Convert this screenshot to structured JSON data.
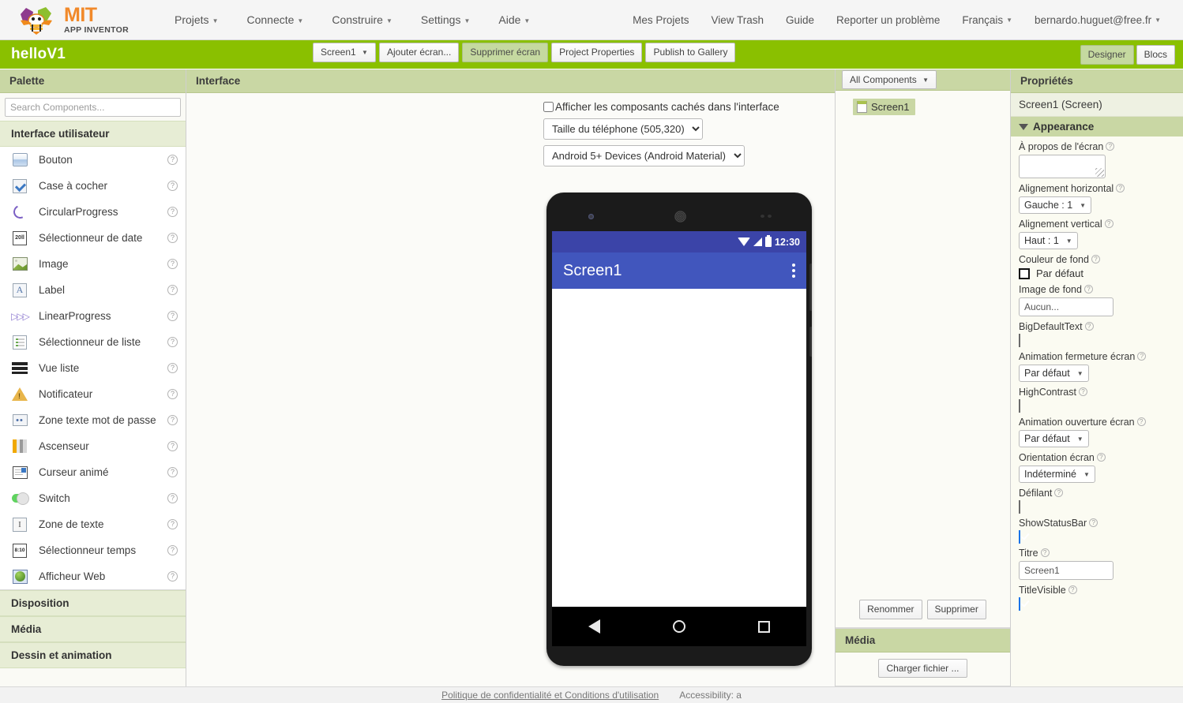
{
  "topbar": {
    "logo": {
      "mit": "MIT",
      "appinventor": "APP INVENTOR",
      "icon": "app-inventor-bee-logo"
    },
    "menu": [
      {
        "label": "Projets",
        "has_caret": true
      },
      {
        "label": "Connecte",
        "has_caret": true
      },
      {
        "label": "Construire",
        "has_caret": true
      },
      {
        "label": "Settings",
        "has_caret": true
      },
      {
        "label": "Aide",
        "has_caret": true
      }
    ],
    "right_menu": [
      {
        "label": "Mes Projets",
        "has_caret": false
      },
      {
        "label": "View Trash",
        "has_caret": false
      },
      {
        "label": "Guide",
        "has_caret": false
      },
      {
        "label": "Reporter un problème",
        "has_caret": false
      },
      {
        "label": "Français",
        "has_caret": true
      },
      {
        "label": "bernardo.huguet@free.fr",
        "has_caret": true
      }
    ]
  },
  "projectbar": {
    "title": "helloV1",
    "bar_color": "#8ac000",
    "screen_select": "Screen1",
    "buttons": [
      {
        "label": "Ajouter écran...",
        "selected": false
      },
      {
        "label": "Supprimer écran",
        "selected": true
      },
      {
        "label": "Project Properties",
        "selected": false
      },
      {
        "label": "Publish to Gallery",
        "selected": false
      }
    ],
    "view_toggle": [
      {
        "label": "Designer",
        "selected": true
      },
      {
        "label": "Blocs",
        "selected": false
      }
    ]
  },
  "palette": {
    "header": "Palette",
    "search_placeholder": "Search Components...",
    "search_value": "",
    "categories": [
      {
        "label": "Interface utilisateur",
        "expanded": true,
        "items": [
          {
            "label": "Bouton",
            "icon": "button-icon"
          },
          {
            "label": "Case à cocher",
            "icon": "checkbox-icon"
          },
          {
            "label": "CircularProgress",
            "icon": "circular-progress-icon"
          },
          {
            "label": "Sélectionneur de date",
            "icon": "date-picker-icon"
          },
          {
            "label": "Image",
            "icon": "image-icon"
          },
          {
            "label": "Label",
            "icon": "label-icon"
          },
          {
            "label": "LinearProgress",
            "icon": "linear-progress-icon"
          },
          {
            "label": "Sélectionneur de liste",
            "icon": "list-picker-icon"
          },
          {
            "label": "Vue liste",
            "icon": "list-view-icon"
          },
          {
            "label": "Notificateur",
            "icon": "notifier-icon"
          },
          {
            "label": "Zone texte mot de passe",
            "icon": "password-textbox-icon"
          },
          {
            "label": "Ascenseur",
            "icon": "slider-icon"
          },
          {
            "label": "Curseur animé",
            "icon": "spinner-icon"
          },
          {
            "label": "Switch",
            "icon": "switch-icon"
          },
          {
            "label": "Zone de texte",
            "icon": "textbox-icon"
          },
          {
            "label": "Sélectionneur temps",
            "icon": "time-picker-icon"
          },
          {
            "label": "Afficheur Web",
            "icon": "web-viewer-icon"
          }
        ]
      },
      {
        "label": "Disposition",
        "expanded": false,
        "items": []
      },
      {
        "label": "Média",
        "expanded": false,
        "items": []
      },
      {
        "label": "Dessin et animation",
        "expanded": false,
        "items": []
      }
    ],
    "help_glyph": "?"
  },
  "viewer": {
    "header": "Interface",
    "hidden_components_label": "Afficher les composants cachés dans l'interface",
    "hidden_components_checked": false,
    "size_select": "Taille du téléphone (505,320)",
    "theme_select": "Android 5+ Devices (Android Material)",
    "phone": {
      "status_time": "12:30",
      "title": "Screen1",
      "status_icons": [
        "wifi-icon",
        "signal-icon",
        "battery-icon"
      ],
      "overflow_icon": "kebab-menu-icon",
      "nav_icons": [
        "back-nav-icon",
        "home-nav-icon",
        "recents-nav-icon"
      ],
      "status_bar_color": "#3b44a8",
      "title_bar_color": "#4156bd"
    }
  },
  "components": {
    "filter_select": "All Components",
    "tree": [
      {
        "label": "Screen1",
        "icon": "screen-node-icon",
        "selected": true
      }
    ],
    "rename_label": "Renommer",
    "delete_label": "Supprimer",
    "media_header": "Média",
    "upload_label": "Charger fichier ..."
  },
  "properties": {
    "header": "Propriétés",
    "subject": "Screen1 (Screen)",
    "section": "Appearance",
    "section_expanded": true,
    "items": [
      {
        "name": "À propos de l'écran",
        "type": "textarea",
        "value": ""
      },
      {
        "name": "Alignement horizontal",
        "type": "select",
        "value": "Gauche : 1"
      },
      {
        "name": "Alignement vertical",
        "type": "select",
        "value": "Haut : 1"
      },
      {
        "name": "Couleur de fond",
        "type": "color",
        "value": "Par défaut",
        "swatch": "#ffffff"
      },
      {
        "name": "Image de fond",
        "type": "input",
        "value": "Aucun..."
      },
      {
        "name": "BigDefaultText",
        "type": "checkbox",
        "checked": false
      },
      {
        "name": "Animation fermeture écran",
        "type": "select",
        "value": "Par défaut"
      },
      {
        "name": "HighContrast",
        "type": "checkbox",
        "checked": false
      },
      {
        "name": "Animation ouverture écran",
        "type": "select",
        "value": "Par défaut"
      },
      {
        "name": "Orientation écran",
        "type": "select",
        "value": "Indéterminé"
      },
      {
        "name": "Défilant",
        "type": "checkbox",
        "checked": false
      },
      {
        "name": "ShowStatusBar",
        "type": "checkbox",
        "checked": true
      },
      {
        "name": "Titre",
        "type": "input",
        "value": "Screen1"
      },
      {
        "name": "TitleVisible",
        "type": "checkbox",
        "checked": true
      }
    ],
    "help_glyph": "?"
  },
  "footer": {
    "privacy_link": "Politique de confidentialité et Conditions d'utilisation",
    "accessibility": "Accessibility: a"
  }
}
